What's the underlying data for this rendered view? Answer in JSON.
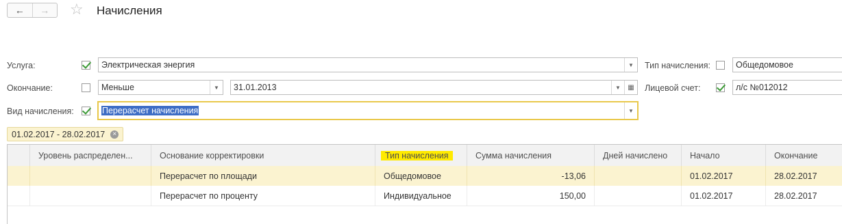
{
  "header": {
    "back_icon": "←",
    "forward_icon": "→",
    "star_icon": "☆",
    "title": "Начисления"
  },
  "filters": {
    "service": {
      "label": "Услуга:",
      "checked": true,
      "value": "Электрическая энергия"
    },
    "end": {
      "label": "Окончание:",
      "checked": false,
      "compare": "Меньше",
      "date": "31.01.2013"
    },
    "kind": {
      "label": "Вид начисления:",
      "checked": true,
      "value": "Перерасчет начисления"
    },
    "charge_type": {
      "label": "Тип начисления:",
      "checked": false,
      "value": "Общедомовое"
    },
    "account": {
      "label": "Лицевой счет:",
      "checked": true,
      "value": "л/с №012012"
    }
  },
  "period_chip": "01.02.2017 - 28.02.2017",
  "table": {
    "columns": [
      "Уровень распределен...",
      "Основание корректировки",
      "Тип начисления",
      "Сумма начисления",
      "Дней начислено",
      "Начало",
      "Окончание"
    ],
    "rows": [
      [
        "",
        "Перерасчет по площади",
        "Общедомовое",
        "-13,06",
        "",
        "01.02.2017",
        "28.02.2017"
      ],
      [
        "",
        "Перерасчет по проценту",
        "Индивидуальное",
        "150,00",
        "",
        "01.02.2017",
        "28.02.2017"
      ]
    ]
  }
}
